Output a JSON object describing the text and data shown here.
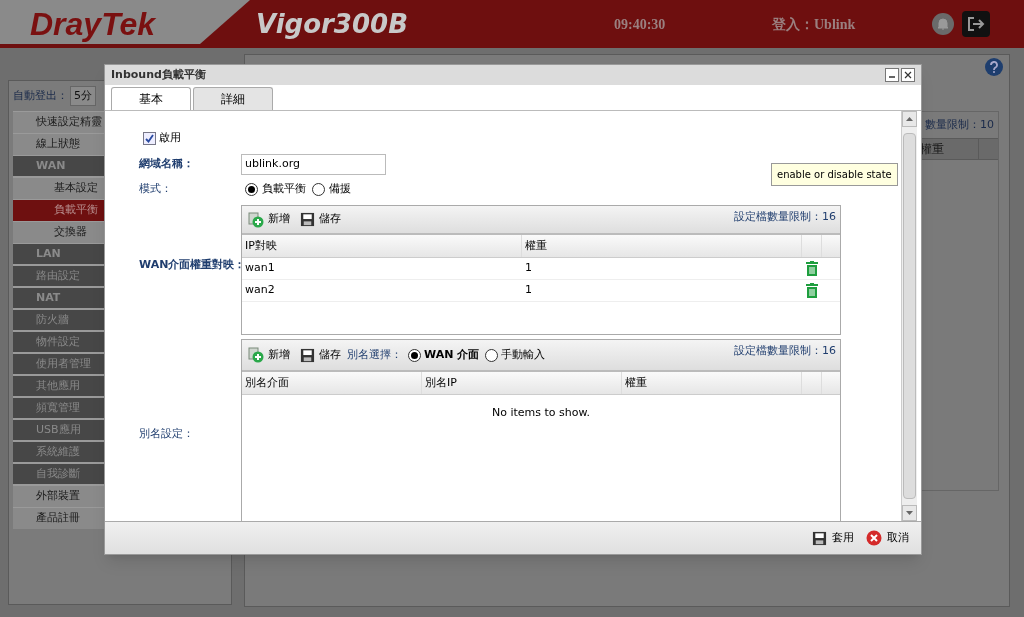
{
  "header": {
    "logo": "DrayTek",
    "model": "Vigor300B",
    "time": "09:40:30",
    "login": "登入：Ublink"
  },
  "sidebar": {
    "auto_logout_label": "自動登出：",
    "auto_logout_value": "5分",
    "items": [
      {
        "label": "快速設定精靈",
        "kind": "link",
        "selected": false
      },
      {
        "label": "線上狀態",
        "kind": "link",
        "selected": false
      },
      {
        "label": "WAN",
        "kind": "category",
        "selected": false
      },
      {
        "label": "基本設定",
        "kind": "sub",
        "selected": false
      },
      {
        "label": "負載平衡",
        "kind": "sub",
        "selected": true
      },
      {
        "label": "交換器",
        "kind": "sub",
        "selected": false
      },
      {
        "label": "LAN",
        "kind": "category",
        "selected": false
      },
      {
        "label": "路由設定",
        "kind": "group",
        "selected": false
      },
      {
        "label": "NAT",
        "kind": "category",
        "selected": false
      },
      {
        "label": "防火牆",
        "kind": "group",
        "selected": false
      },
      {
        "label": "物件設定",
        "kind": "group",
        "selected": false
      },
      {
        "label": "使用者管理",
        "kind": "group",
        "selected": false
      },
      {
        "label": "其他應用",
        "kind": "group",
        "selected": false
      },
      {
        "label": "頻寬管理",
        "kind": "group",
        "selected": false
      },
      {
        "label": "USB應用",
        "kind": "group",
        "selected": false
      },
      {
        "label": "系統維護",
        "kind": "group",
        "selected": false
      },
      {
        "label": "自我診斷",
        "kind": "group",
        "selected": false
      },
      {
        "label": "外部裝置",
        "kind": "link",
        "selected": false
      },
      {
        "label": "產品註冊",
        "kind": "link",
        "selected": false
      }
    ]
  },
  "background_panel": {
    "limit": "數量限制：10",
    "column": "權重"
  },
  "dialog": {
    "title": "Inbound負載平衡",
    "tabs": [
      {
        "label": "基本",
        "selected": true
      },
      {
        "label": "詳細",
        "selected": false
      }
    ],
    "enable": {
      "label": "啟用",
      "checked": true
    },
    "domain": {
      "label": "網域名稱：",
      "value": "ublink.org"
    },
    "mode": {
      "label": "模式：",
      "options": [
        {
          "label": "負載平衡",
          "selected": true
        },
        {
          "label": "備援",
          "selected": false
        }
      ]
    },
    "wan_weight": {
      "label": "WAN介面權重對映：",
      "add": "新增",
      "save": "儲存",
      "limit": "設定檔數量限制：16",
      "columns": [
        "IP對映",
        "權重"
      ],
      "rows": [
        {
          "ip": "wan1",
          "weight": "1"
        },
        {
          "ip": "wan2",
          "weight": "1"
        }
      ]
    },
    "alias": {
      "label": "別名設定：",
      "add": "新增",
      "save": "儲存",
      "select_label": "別名選擇：",
      "limit": "設定檔數量限制：16",
      "options": [
        {
          "label": "WAN 介面",
          "selected": true,
          "bold": true
        },
        {
          "label": "手動輸入",
          "selected": false,
          "bold": false
        }
      ],
      "columns": [
        "別名介面",
        "別名IP",
        "權重"
      ],
      "empty": "No items to show."
    },
    "tooltip": "enable or disable state",
    "apply": "套用",
    "cancel": "取消"
  }
}
